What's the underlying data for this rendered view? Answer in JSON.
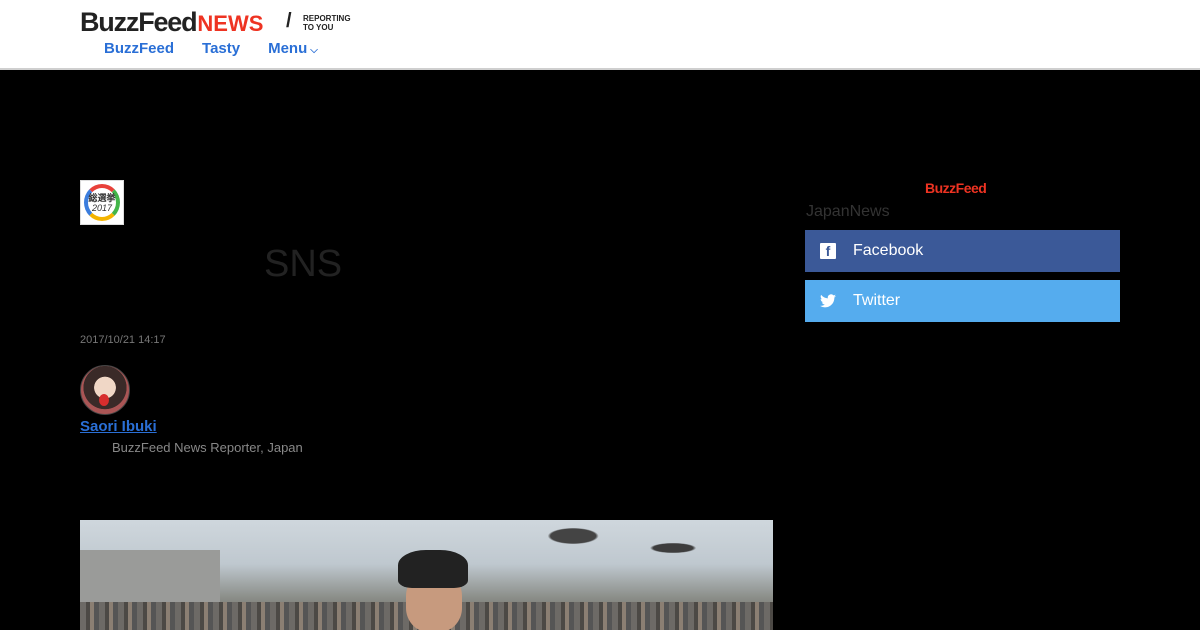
{
  "header": {
    "logo_main": "BuzzFeed",
    "logo_news": "NEWS",
    "logo_slash": "/",
    "logo_tag_line1": "REPORTING",
    "logo_tag_line2": "TO YOU",
    "nav": [
      {
        "label": "BuzzFeed"
      },
      {
        "label": "Tasty"
      },
      {
        "label": "Menu"
      }
    ]
  },
  "article": {
    "badge_text": "総選挙",
    "badge_year": "2017",
    "title": "SNS",
    "date": "2017/10/21 14:17",
    "author_name": "Saori Ibuki",
    "author_role": "BuzzFeed News Reporter, Japan"
  },
  "sidebar": {
    "logo": "BuzzFeed",
    "label": "JapanNews",
    "share": [
      {
        "label": "Facebook",
        "icon": "facebook-icon"
      },
      {
        "label": "Twitter",
        "icon": "twitter-icon"
      }
    ]
  },
  "colors": {
    "brand_red": "#ee3322",
    "link_blue": "#2a6fd6",
    "facebook": "#3b5998",
    "twitter": "#55acee"
  }
}
